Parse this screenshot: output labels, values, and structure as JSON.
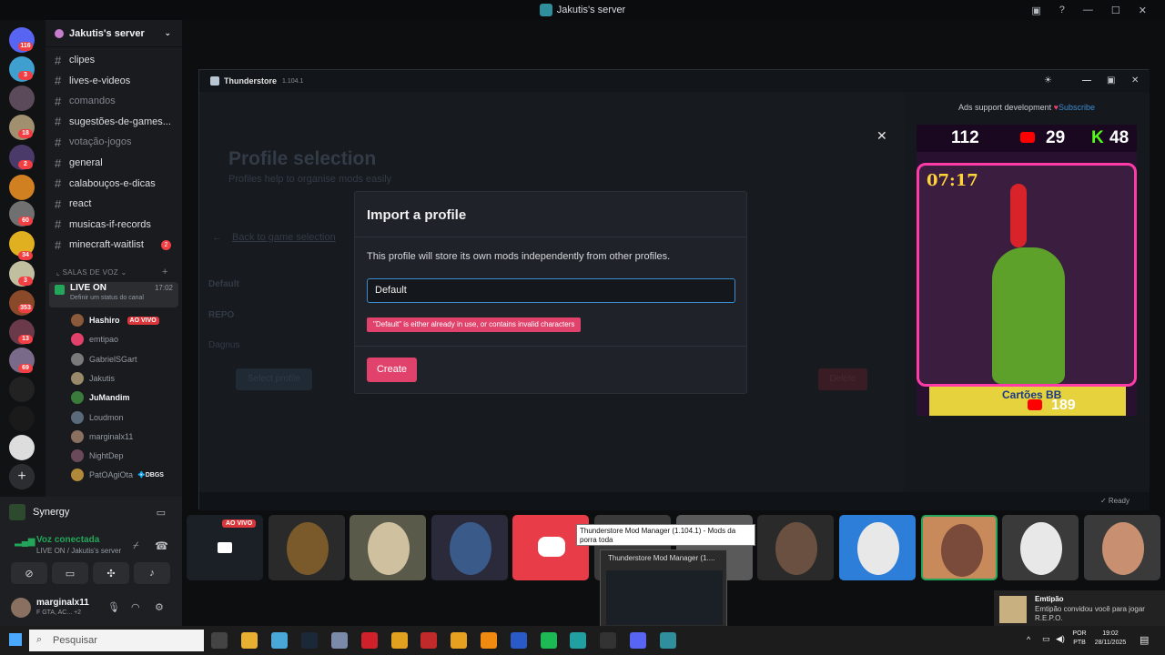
{
  "window": {
    "title": "Jakutis's server"
  },
  "server_rail": {
    "badges": [
      {
        "name": "discord-home-badge",
        "value": "116"
      },
      {
        "name": "server-badge-1",
        "value": "3"
      },
      {
        "name": "server-badge-2",
        "value": "18"
      },
      {
        "name": "server-badge-3",
        "value": "2"
      },
      {
        "name": "server-badge-4",
        "value": "60"
      },
      {
        "name": "server-badge-5",
        "value": "34"
      },
      {
        "name": "server-badge-6",
        "value": "3"
      },
      {
        "name": "server-badge-7",
        "value": "353"
      },
      {
        "name": "server-badge-8",
        "value": "13"
      },
      {
        "name": "server-badge-9",
        "value": "69"
      }
    ]
  },
  "sidebar": {
    "server_name": "Jakutis's server",
    "channels": [
      {
        "label": "clipes",
        "muted": false
      },
      {
        "label": "lives-e-videos",
        "muted": false
      },
      {
        "label": "comandos",
        "muted": true
      },
      {
        "label": "sugestões-de-games...",
        "muted": false
      },
      {
        "label": "votação-jogos",
        "muted": true
      },
      {
        "label": "general",
        "muted": false
      },
      {
        "label": "calabouços-e-dicas",
        "muted": false
      },
      {
        "label": "react",
        "muted": false
      },
      {
        "label": "musicas-if-records",
        "muted": false
      },
      {
        "label": "minecraft-waitlist",
        "muted": false
      }
    ],
    "minecraft_count": "2",
    "voice_category": "SALAS DE VOZ",
    "voice_channel": {
      "name": "LIVE ON",
      "time": "17:02",
      "status": "Definir um status do canal"
    },
    "voice_users": [
      {
        "name": "Hashiro",
        "live": "AO VIVO",
        "hi": true,
        "color": "#8a5a3a"
      },
      {
        "name": "emtipao",
        "hi": false,
        "color": "#e0426b"
      },
      {
        "name": "GabrielSGart",
        "hi": false,
        "color": "#7a7a7a"
      },
      {
        "name": "Jakutis",
        "hi": false,
        "color": "#9a8a6a"
      },
      {
        "name": "JuMandim",
        "hi": true,
        "color": "#3a7a3a"
      },
      {
        "name": "Loudmon",
        "hi": false,
        "color": "#5a6a7a"
      },
      {
        "name": "marginalx11",
        "hi": false,
        "color": "#8a7060"
      },
      {
        "name": "NightDep",
        "hi": false,
        "color": "#6a4a5a"
      },
      {
        "name": "PatOAgiOta",
        "hi": false,
        "color": "#b08a3a",
        "tag": "DBGS"
      }
    ]
  },
  "user_panel": {
    "activity": "Synergy",
    "voice_status": "Voz conectada",
    "voice_location": "LIVE ON / Jakutis's server",
    "username": "marginalx11",
    "game": "F GTA, AC... +2"
  },
  "thunderstore": {
    "app_name": "Thunderstore",
    "version": "1.104.1",
    "page_title": "Profile selection",
    "page_subtitle": "Profiles help to organise mods easily",
    "back_link": "Back to game selection",
    "profiles": [
      "Default",
      "REPO",
      "Dagnus"
    ],
    "select_button": "Select profile",
    "delete_button": "Delete",
    "status": "Ready",
    "ad": {
      "text": "Ads support development",
      "subscribe": "Subscribe"
    }
  },
  "modal": {
    "title": "Import a profile",
    "description": "This profile will store its own mods independently from other profiles.",
    "input_value": "Default",
    "error": "\"Default\" is either already in use, or contains invalid characters",
    "create_label": "Create"
  },
  "ad_image": {
    "top_a": "112",
    "top_b": "29",
    "top_c": "48",
    "timer": "07:17",
    "banner": "Cartões BB",
    "banner_num": "189"
  },
  "strip": {
    "live_label": "AO VIVO"
  },
  "tooltip": "Thunderstore Mod Manager (1.104.1) - Mods da porra toda",
  "preview_title": "Thunderstore Mod Manager (1....",
  "notification": {
    "title": "Emtipão",
    "body": "Emtipão convidou você para jogar R.E.P.O."
  },
  "taskbar": {
    "search": "Pesquisar",
    "lang": "POR",
    "kbd": "PTB",
    "time": "19:02",
    "date": "28/11/2025"
  },
  "colors": {
    "accent": "#e0426b",
    "discord_red": "#f23f43",
    "green": "#23a55a",
    "focus_blue": "#3c8cd0"
  }
}
